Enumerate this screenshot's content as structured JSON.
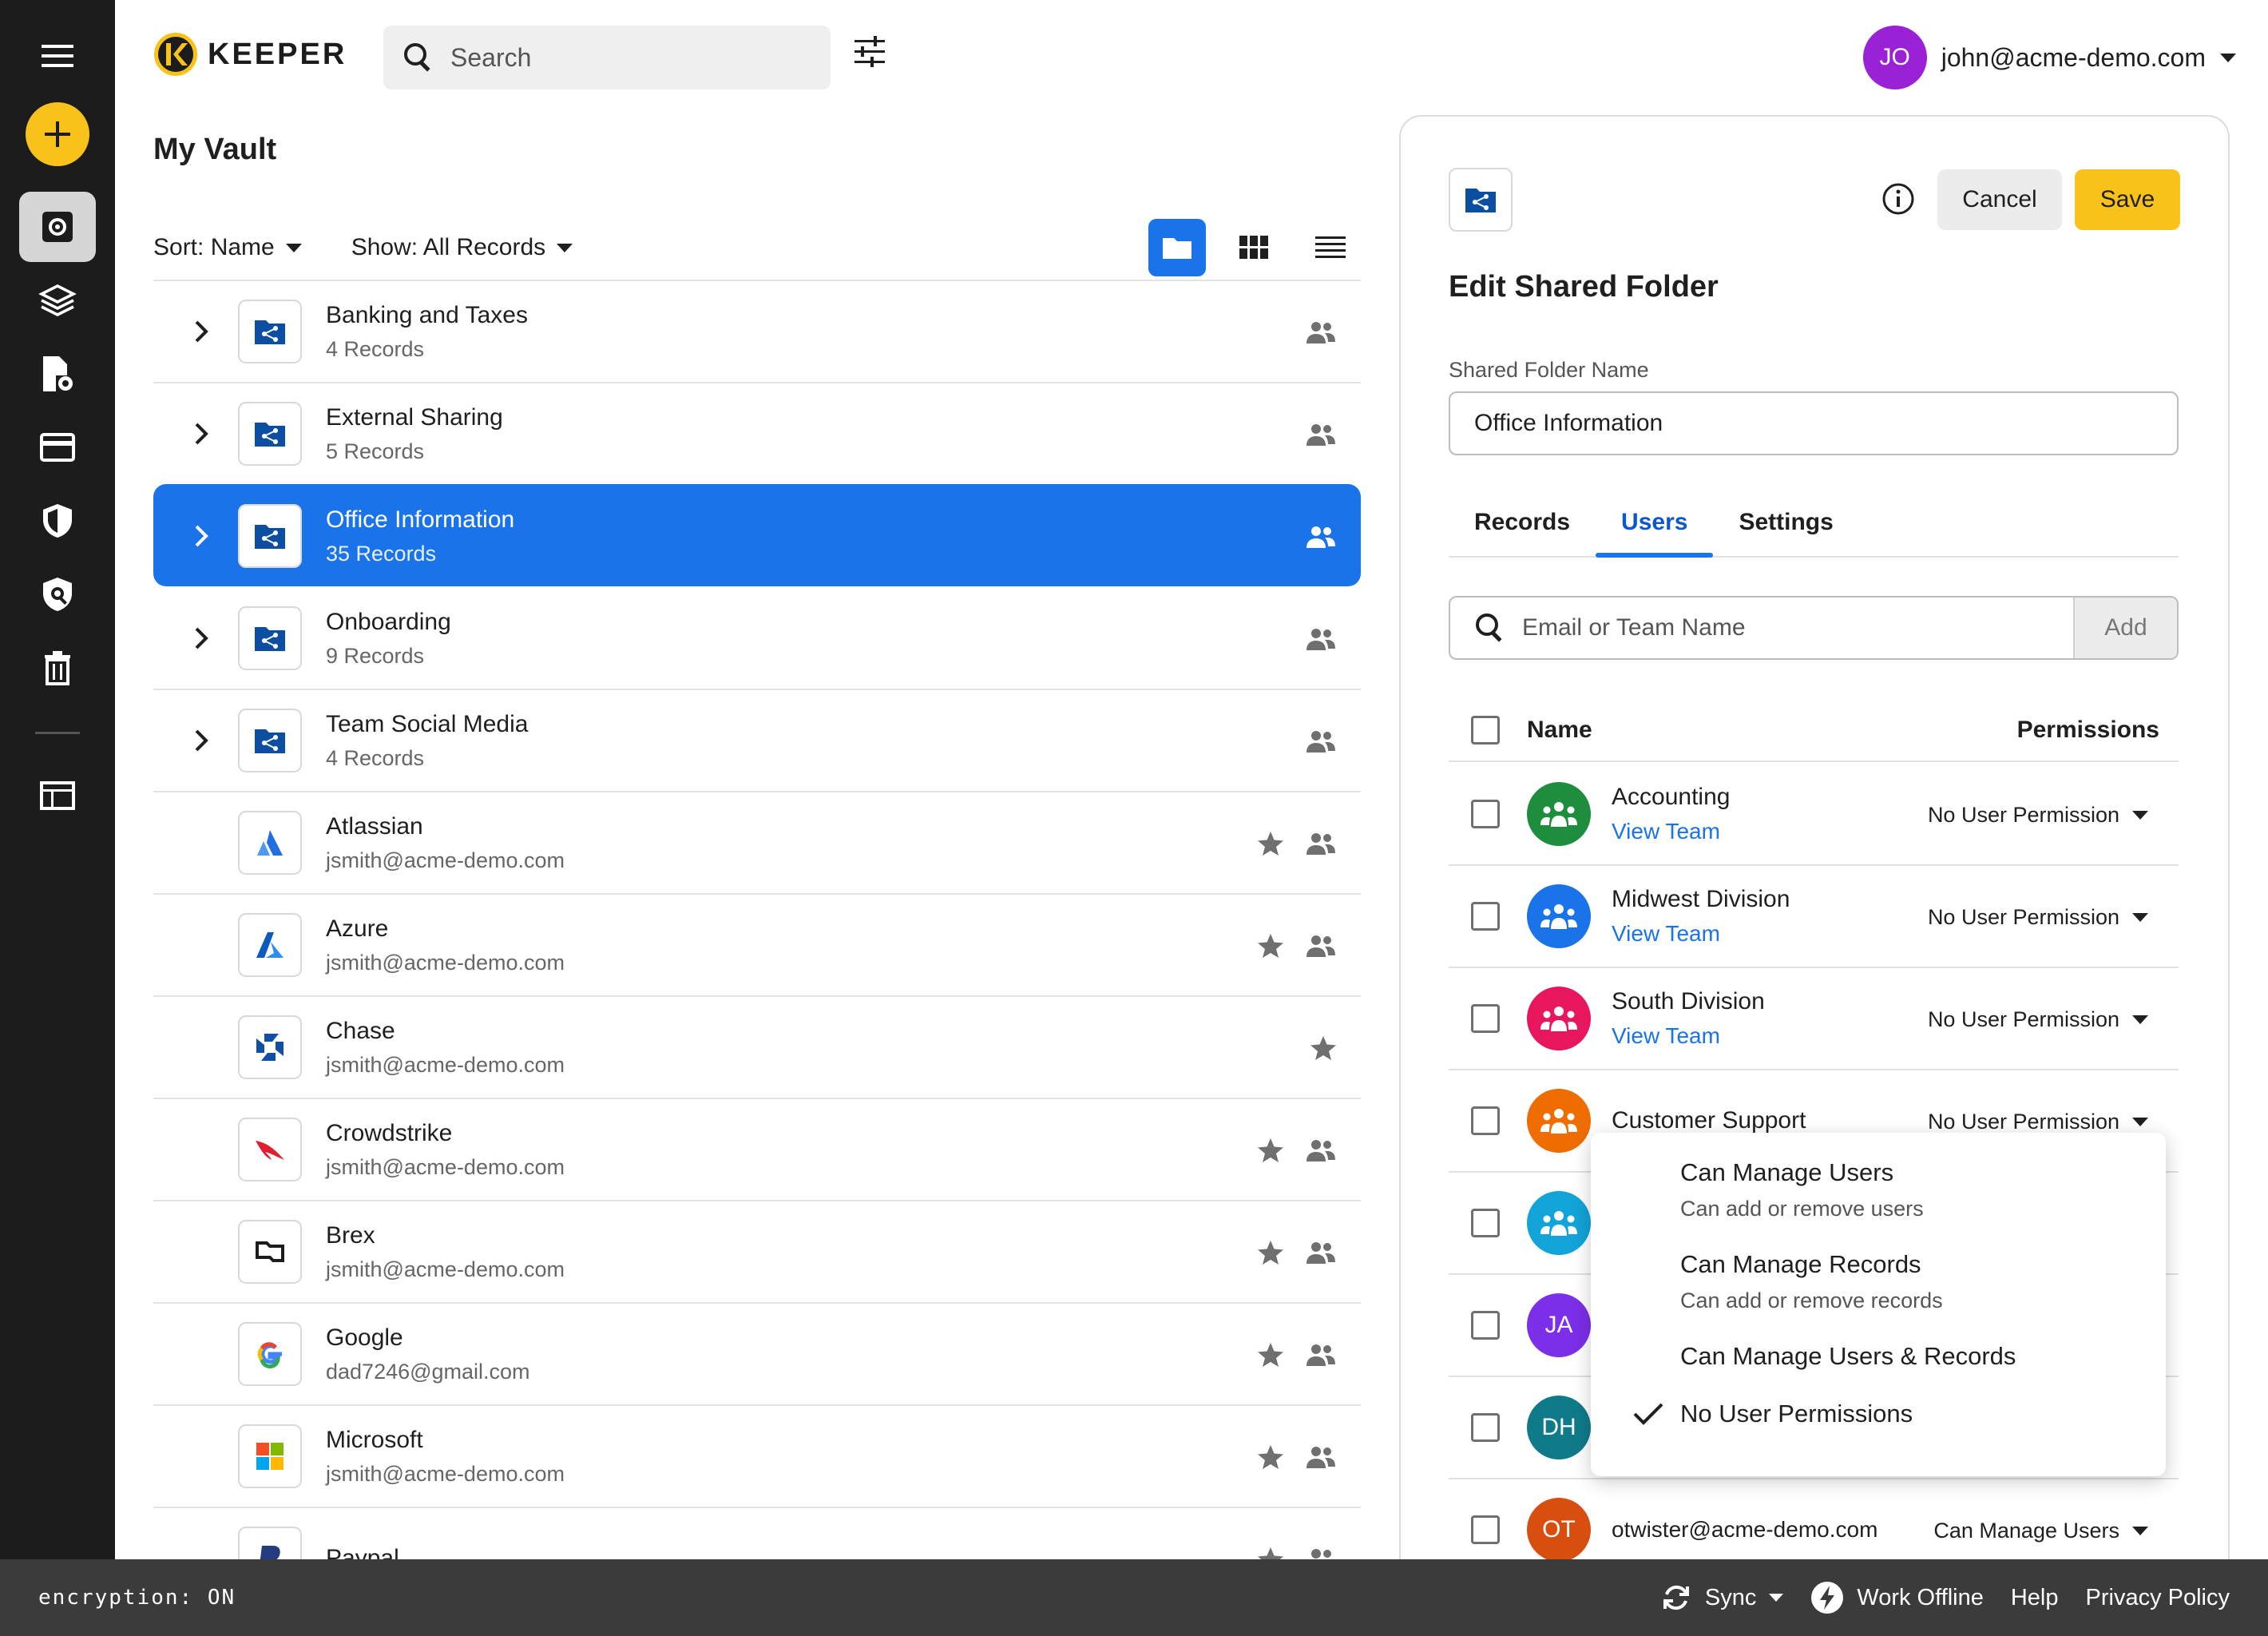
{
  "app": {
    "brand": "KEEPER",
    "accent_color": "#f9c21a",
    "selection_color": "#1a73e8"
  },
  "topbar": {
    "search_placeholder": "Search",
    "account_initials": "JO",
    "account_email": "john@acme-demo.com"
  },
  "sidebar": {
    "icons": [
      "menu-icon",
      "add-icon",
      "vault-icon",
      "layers-icon",
      "file-settings-icon",
      "card-icon",
      "shield-icon",
      "breach-watch-icon",
      "trash-icon",
      "layout-icon"
    ]
  },
  "vault": {
    "title": "My Vault",
    "sort_label": "Sort: Name",
    "show_label": "Show: All Records",
    "items": [
      {
        "title": "Banking and Taxes",
        "subtitle": "4 Records",
        "kind": "folder",
        "star": false,
        "shared": true
      },
      {
        "title": "External Sharing",
        "subtitle": "5 Records",
        "kind": "folder",
        "star": false,
        "shared": true
      },
      {
        "title": "Office Information",
        "subtitle": "35 Records",
        "kind": "folder",
        "star": false,
        "shared": true,
        "selected": true
      },
      {
        "title": "Onboarding",
        "subtitle": "9 Records",
        "kind": "folder",
        "star": false,
        "shared": true
      },
      {
        "title": "Team Social Media",
        "subtitle": "4 Records",
        "kind": "folder",
        "star": false,
        "shared": true
      },
      {
        "title": "Atlassian",
        "subtitle": "jsmith@acme-demo.com",
        "kind": "atlassian",
        "star": true,
        "shared": true
      },
      {
        "title": "Azure",
        "subtitle": "jsmith@acme-demo.com",
        "kind": "azure",
        "star": true,
        "shared": true
      },
      {
        "title": "Chase",
        "subtitle": "jsmith@acme-demo.com",
        "kind": "chase",
        "star": true,
        "shared": false
      },
      {
        "title": "Crowdstrike",
        "subtitle": "jsmith@acme-demo.com",
        "kind": "crowdstrike",
        "star": true,
        "shared": true
      },
      {
        "title": "Brex",
        "subtitle": "jsmith@acme-demo.com",
        "kind": "brex",
        "star": true,
        "shared": true
      },
      {
        "title": "Google",
        "subtitle": "dad7246@gmail.com",
        "kind": "google",
        "star": true,
        "shared": true
      },
      {
        "title": "Microsoft",
        "subtitle": "jsmith@acme-demo.com",
        "kind": "microsoft",
        "star": true,
        "shared": true
      },
      {
        "title": "Paypal",
        "subtitle": "",
        "kind": "paypal",
        "star": true,
        "shared": true
      }
    ]
  },
  "panel": {
    "title": "Edit Shared Folder",
    "cancel_label": "Cancel",
    "save_label": "Save",
    "field_label": "Shared Folder Name",
    "field_value": "Office Information",
    "tabs": [
      {
        "label": "Records"
      },
      {
        "label": "Users"
      },
      {
        "label": "Settings"
      }
    ],
    "active_tab": "Users",
    "add_placeholder": "Email or Team Name",
    "add_label": "Add",
    "col_name": "Name",
    "col_permissions": "Permissions",
    "users": [
      {
        "name": "Accounting",
        "link": "View Team",
        "color": "#1e8e3e",
        "type": "team",
        "permission": "No User Permission"
      },
      {
        "name": "Midwest Division",
        "link": "View Team",
        "color": "#1a73e8",
        "type": "team",
        "permission": "No User Permission"
      },
      {
        "name": "South Division",
        "link": "View Team",
        "color": "#e8175d",
        "type": "team",
        "permission": "No User Permission"
      },
      {
        "name": "Customer Support",
        "link": "",
        "color": "#ef6c00",
        "type": "team",
        "permission": "No User Permission"
      },
      {
        "name": "",
        "link": "",
        "color": "#12a4d9",
        "type": "team",
        "permission": ""
      },
      {
        "name": "",
        "link": "",
        "initials": "JA",
        "color": "#7c2ee8",
        "type": "user",
        "permission": ""
      },
      {
        "name": "",
        "link": "",
        "initials": "DH",
        "color": "#0f7b8a",
        "type": "user",
        "permission": ""
      },
      {
        "name": "",
        "link": "",
        "initials": "OT",
        "color": "#d84e0f",
        "type": "user",
        "email": "otwister@acme-demo.com",
        "permission": "Can Manage Users"
      }
    ]
  },
  "permission_menu": {
    "items": [
      {
        "title": "Can Manage Users",
        "desc": "Can add or remove users",
        "checked": false
      },
      {
        "title": "Can Manage Records",
        "desc": "Can add or remove records",
        "checked": false
      },
      {
        "title": "Can Manage Users & Records",
        "desc": "",
        "checked": false
      },
      {
        "title": "No User Permissions",
        "desc": "",
        "checked": true
      }
    ]
  },
  "footer": {
    "encryption": "encryption: ON",
    "sync": "Sync",
    "offline": "Work Offline",
    "help": "Help",
    "privacy": "Privacy Policy"
  }
}
